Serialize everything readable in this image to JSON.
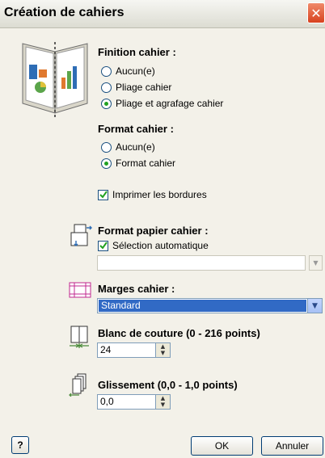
{
  "window": {
    "title": "Création de cahiers",
    "close_glyph": "✕"
  },
  "finition": {
    "label": "Finition cahier :",
    "options": [
      {
        "label": "Aucun(e)",
        "selected": false
      },
      {
        "label": "Pliage cahier",
        "selected": false
      },
      {
        "label": "Pliage et agrafage cahier",
        "selected": true
      }
    ]
  },
  "format": {
    "label": "Format cahier :",
    "options": [
      {
        "label": "Aucun(e)",
        "selected": false
      },
      {
        "label": "Format cahier",
        "selected": true
      }
    ]
  },
  "print_borders": {
    "label": "Imprimer les bordures",
    "checked": true
  },
  "paper_format": {
    "label": "Format papier cahier :",
    "auto_select": {
      "label": "Sélection automatique",
      "checked": true
    },
    "value": ""
  },
  "margins": {
    "label": "Marges cahier :",
    "value": "Standard"
  },
  "gutter": {
    "label": "Blanc de couture (0 - 216 points)",
    "value": "24"
  },
  "creep": {
    "label": "Glissement (0,0 - 1,0 points)",
    "value": "0,0"
  },
  "buttons": {
    "help": "?",
    "ok": "OK",
    "cancel": "Annuler"
  },
  "icons": [
    "booklet-icon",
    "paper-size-icon",
    "margins-icon",
    "gutter-icon",
    "creep-icon",
    "help-icon",
    "close-icon"
  ]
}
